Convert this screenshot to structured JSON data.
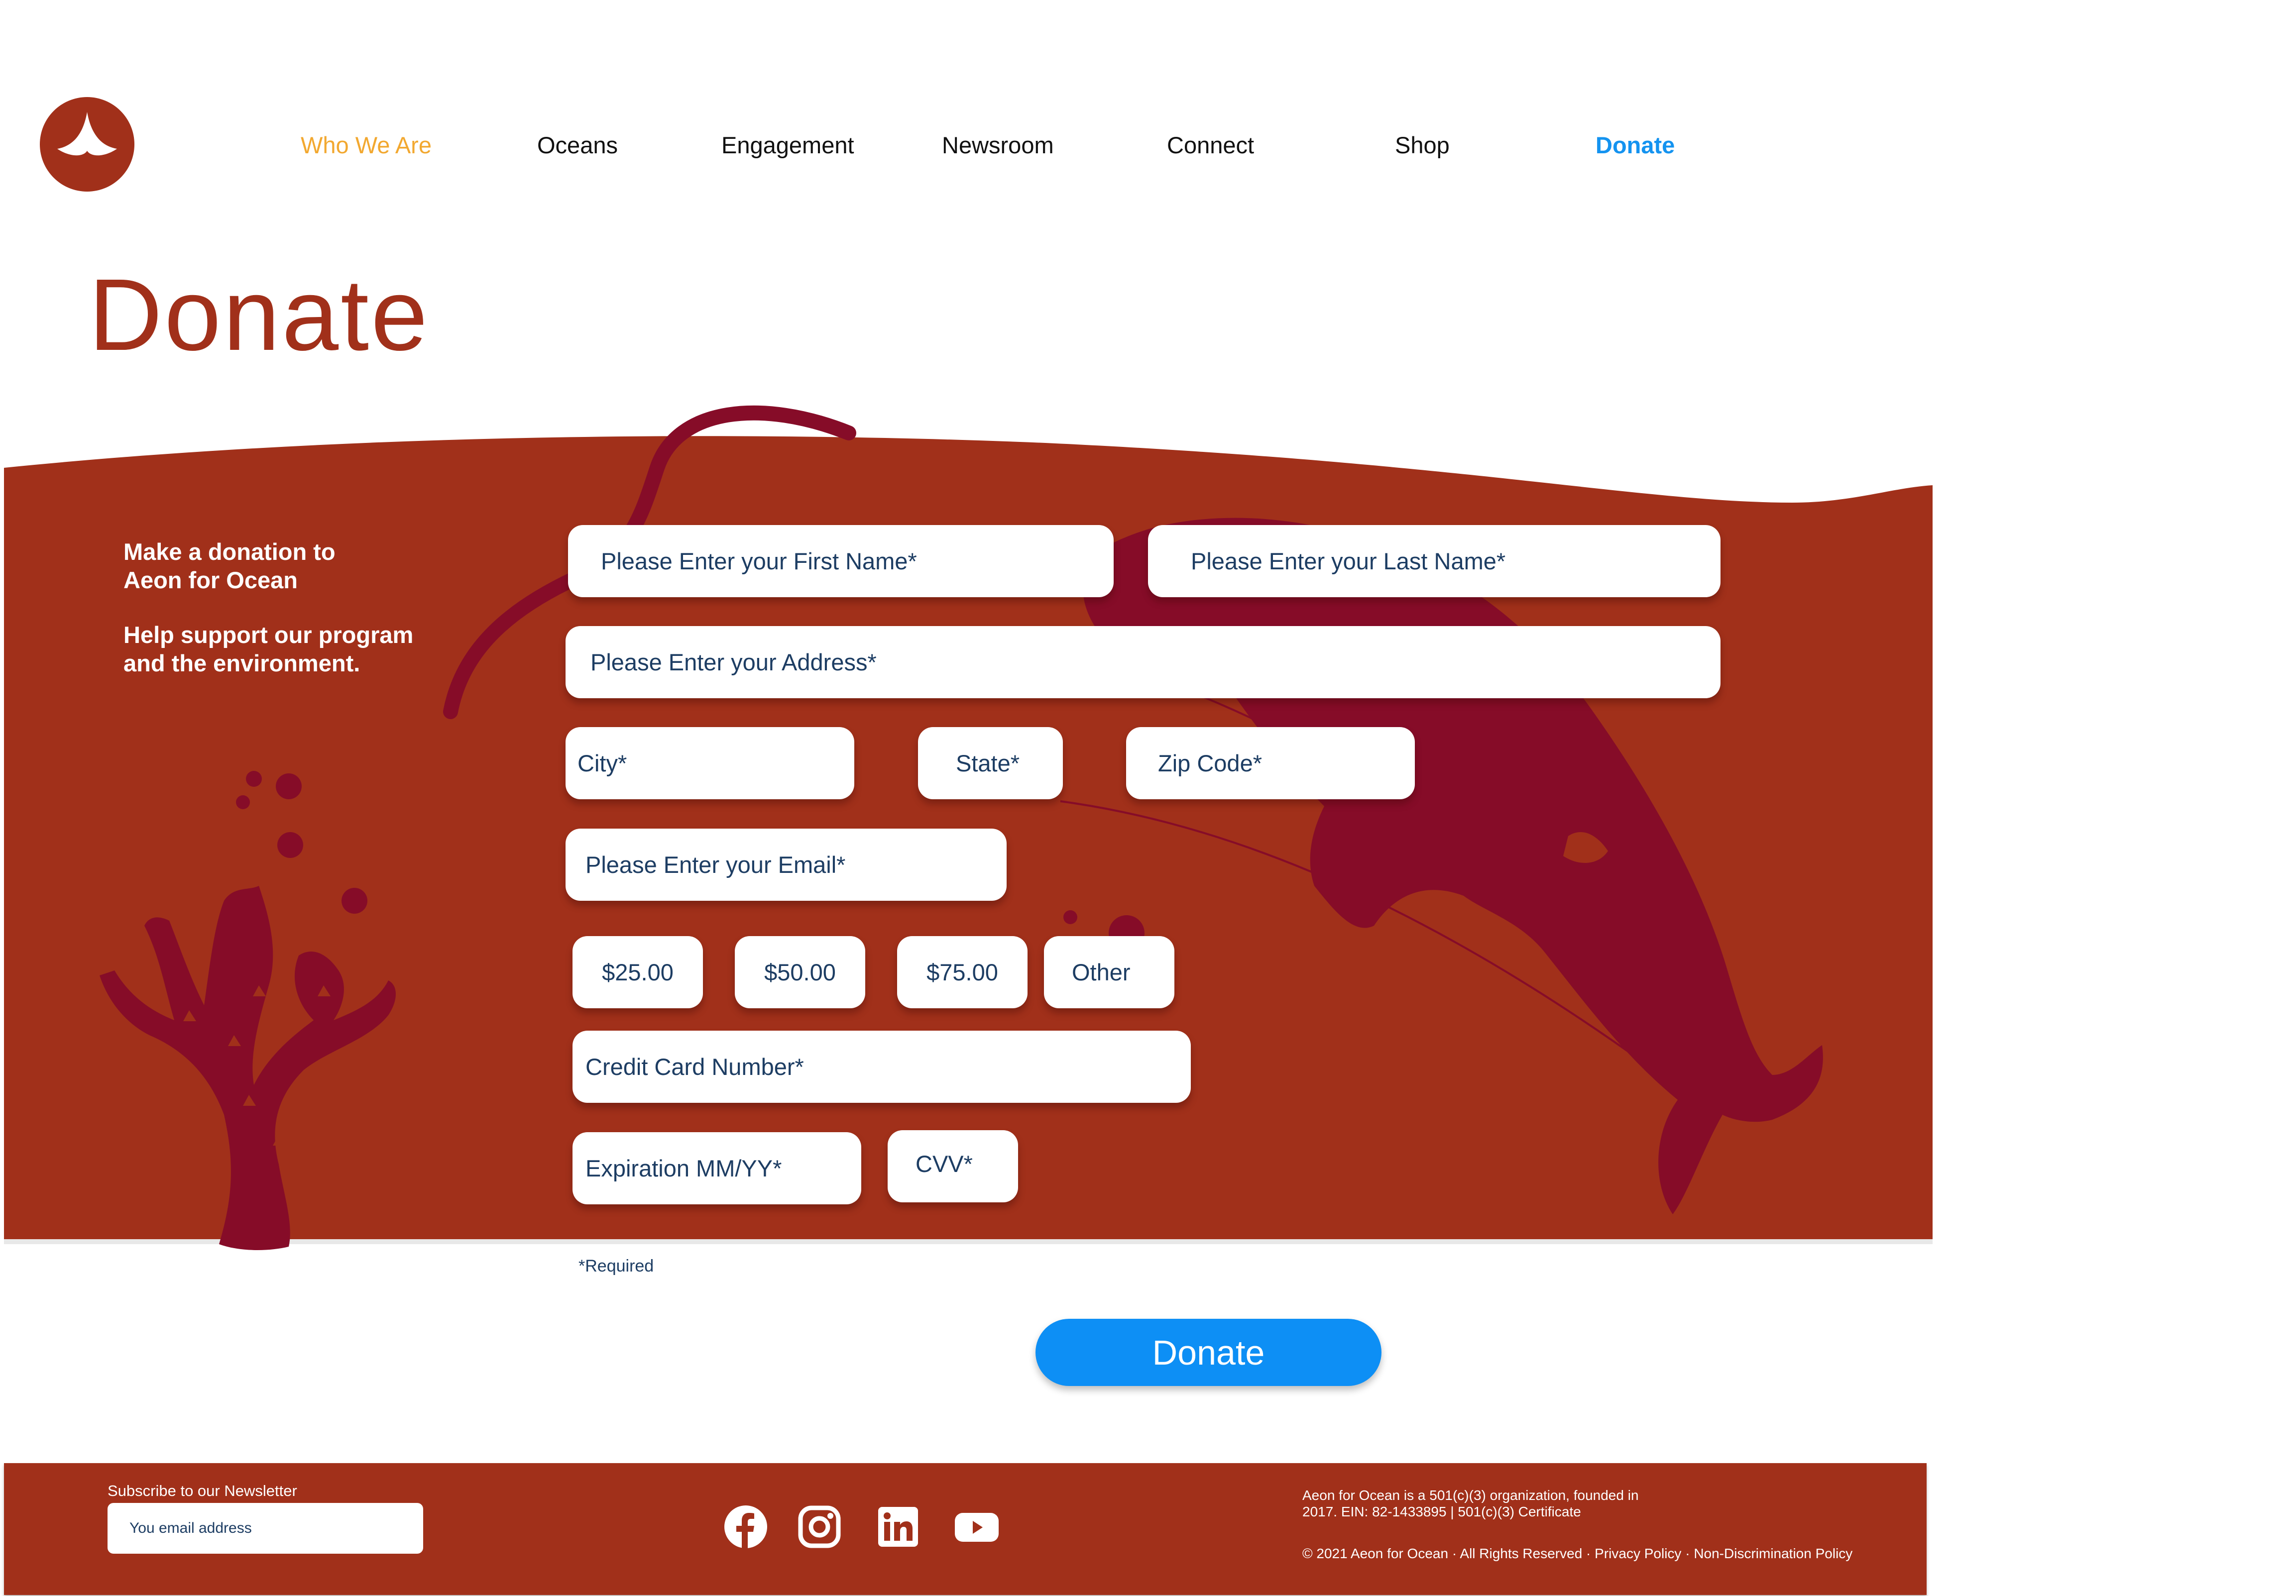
{
  "nav": {
    "items": [
      {
        "label": "Who We Are",
        "state": "active"
      },
      {
        "label": "Oceans"
      },
      {
        "label": "Engagement"
      },
      {
        "label": "Newsroom"
      },
      {
        "label": "Connect"
      },
      {
        "label": "Shop"
      },
      {
        "label": "Donate",
        "state": "cta"
      }
    ]
  },
  "page": {
    "title": "Donate"
  },
  "intro": {
    "line1": "Make a donation to",
    "line2": "Aeon for Ocean",
    "line3": "Help support our program",
    "line4": "and the environment."
  },
  "form": {
    "first_name": "Please Enter your First Name*",
    "last_name": "Please Enter your Last Name*",
    "address": "Please Enter your Address*",
    "city": "City*",
    "state": "State*",
    "zip": "Zip Code*",
    "email": "Please Enter your Email*",
    "amounts": [
      "$25.00",
      "$50.00",
      "$75.00",
      "Other"
    ],
    "card_number": "Credit Card Number*",
    "expiration": "Expiration MM/YY*",
    "cvv": "CVV*",
    "required_note": "*Required",
    "submit_label": "Donate"
  },
  "footer": {
    "newsletter_label": "Subscribe to our Newsletter",
    "newsletter_placeholder": "You email address",
    "social": [
      "facebook-icon",
      "instagram-icon",
      "linkedin-icon",
      "youtube-icon"
    ],
    "org_line1": "Aeon for Ocean is a 501(c)(3) organization, founded in",
    "org_line2": "2017. EIN: 82-1433895 | 501(c)(3) Certificate",
    "copyright": "© 2021 Aeon for Ocean · All Rights Reserved · ",
    "privacy": "Privacy Policy",
    "separator": " · ",
    "nondiscrimination": "Non-Discrimination Policy"
  },
  "colors": {
    "brand_red": "#a1301a",
    "accent_orange": "#f2a830",
    "cta_blue": "#0d8ff5",
    "text_navy": "#1d3d63",
    "silhouette": "#860c28"
  }
}
